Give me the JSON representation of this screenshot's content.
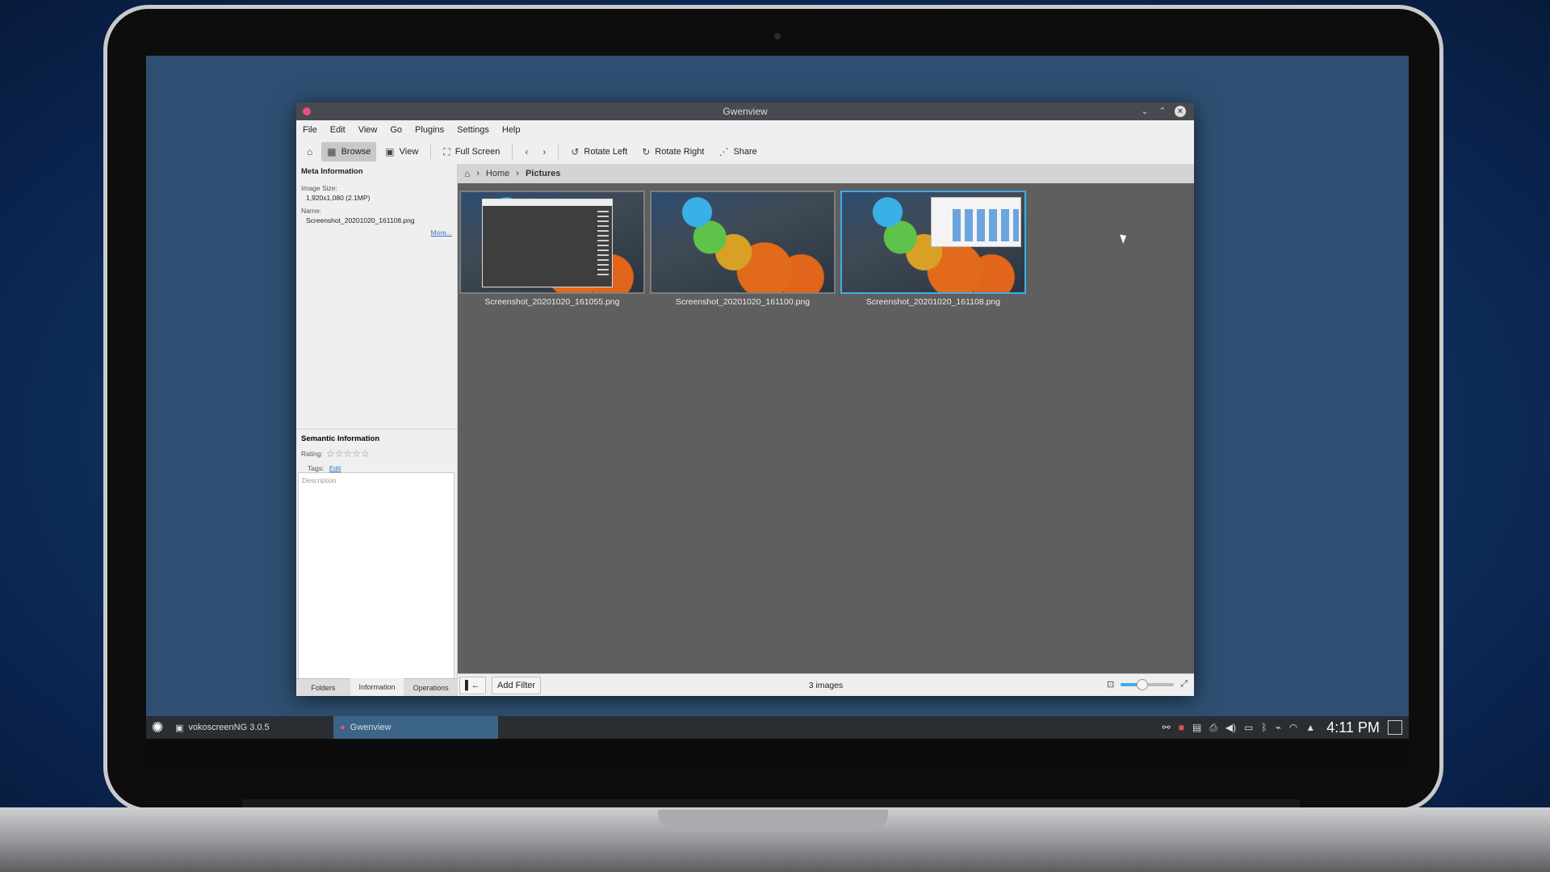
{
  "window": {
    "title": "Gwenview"
  },
  "menu": [
    "File",
    "Edit",
    "View",
    "Go",
    "Plugins",
    "Settings",
    "Help"
  ],
  "toolbar": {
    "browse": "Browse",
    "view": "View",
    "fullscreen": "Full Screen",
    "rotate_left": "Rotate Left",
    "rotate_right": "Rotate Right",
    "share": "Share"
  },
  "breadcrumb": {
    "home": "Home",
    "current": "Pictures"
  },
  "meta": {
    "title": "Meta Information",
    "size_label": "Image Size:",
    "size_value": "1,920x1,080 (2.1MP)",
    "name_label": "Name:",
    "name_value": "Screenshot_20201020_161108.png",
    "more": "More..."
  },
  "semantic": {
    "title": "Semantic Information",
    "rating_label": "Rating:",
    "rating": 0,
    "tags_label": "Tags:",
    "tags_edit": "Edit",
    "description_placeholder": "Description"
  },
  "sidebar_tabs": [
    "Folders",
    "Information",
    "Operations"
  ],
  "thumbnails": [
    {
      "name": "Screenshot_20201020_161055.png"
    },
    {
      "name": "Screenshot_20201020_161100.png"
    },
    {
      "name": "Screenshot_20201020_161108.png"
    }
  ],
  "status": {
    "add_filter": "Add Filter",
    "count": "3 images",
    "zoom": 0.4
  },
  "taskbar": {
    "tasks": [
      "vokoscreenNG 3.0.5",
      "Gwenview"
    ],
    "clock": "4:11 PM"
  }
}
